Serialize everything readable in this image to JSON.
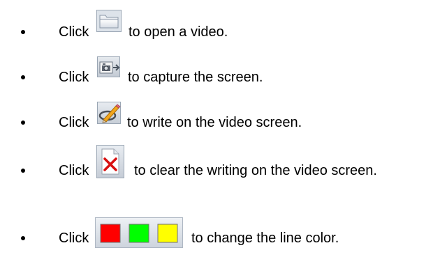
{
  "instructions": [
    {
      "word": "Click",
      "icon": "folder-icon",
      "text": "to open a video."
    },
    {
      "word": "Click",
      "icon": "capture-screen-icon",
      "text": "to capture the screen."
    },
    {
      "word": "Click",
      "icon": "pen-write-icon",
      "text": "to write on the video screen."
    },
    {
      "word": "Click",
      "icon": "clear-writing-icon",
      "text": "to clear the writing on the video screen."
    },
    {
      "word": "Click",
      "icon": "color-swatches-icon",
      "text": "to change the line color."
    }
  ],
  "colors": {
    "swatch_red": "#ff0000",
    "swatch_green": "#00ff00",
    "swatch_yellow": "#ffff00",
    "clear_x": "#d81010"
  }
}
